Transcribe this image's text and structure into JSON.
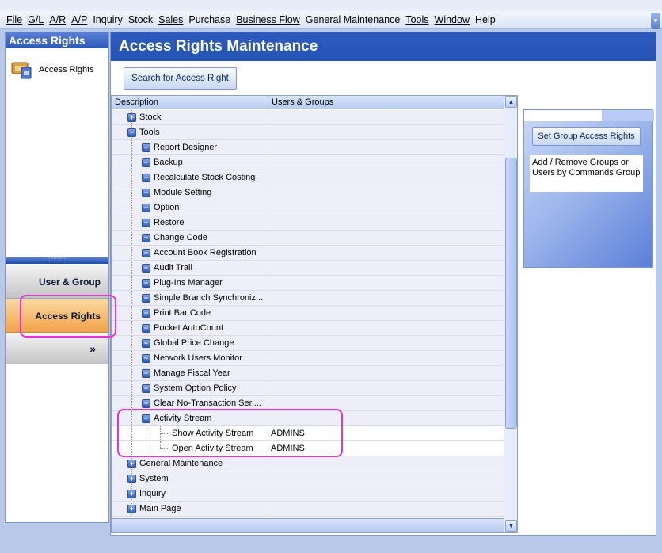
{
  "menu": [
    {
      "label": "File",
      "u": true
    },
    {
      "label": "G/L",
      "u": true
    },
    {
      "label": "A/R",
      "u": true
    },
    {
      "label": "A/P",
      "u": true
    },
    {
      "label": "Inquiry",
      "u": false
    },
    {
      "label": "Stock",
      "u": false
    },
    {
      "label": "Sales",
      "u": true
    },
    {
      "label": "Purchase",
      "u": false
    },
    {
      "label": "Business Flow",
      "u": true
    },
    {
      "label": "General Maintenance",
      "u": false
    },
    {
      "label": "Tools",
      "u": true
    },
    {
      "label": "Window",
      "u": true
    },
    {
      "label": "Help",
      "u": false
    }
  ],
  "nav": {
    "header": "Access Rights",
    "item_label": "Access Rights",
    "grip": "::::::::::",
    "user_group_label": "User & Group",
    "access_rights_label": "Access Rights",
    "more_label": "»"
  },
  "main": {
    "title": "Access Rights Maintenance",
    "search_button": "Search for Access Right",
    "columns": {
      "description": "Description",
      "users_groups": "Users & Groups"
    },
    "rows": [
      {
        "level": 0,
        "label": "Stock",
        "exp": "+",
        "users": ""
      },
      {
        "level": 0,
        "label": "Tools",
        "exp": "-",
        "users": ""
      },
      {
        "level": 1,
        "label": "Report Designer",
        "exp": "+",
        "users": ""
      },
      {
        "level": 1,
        "label": "Backup",
        "exp": "+",
        "users": ""
      },
      {
        "level": 1,
        "label": "Recalculate Stock Costing",
        "exp": "+",
        "users": ""
      },
      {
        "level": 1,
        "label": "Module Setting",
        "exp": "+",
        "users": ""
      },
      {
        "level": 1,
        "label": "Option",
        "exp": "+",
        "users": ""
      },
      {
        "level": 1,
        "label": "Restore",
        "exp": "+",
        "users": ""
      },
      {
        "level": 1,
        "label": "Change Code",
        "exp": "+",
        "users": ""
      },
      {
        "level": 1,
        "label": "Account Book Registration",
        "exp": "+",
        "users": ""
      },
      {
        "level": 1,
        "label": "Audit Trail",
        "exp": "+",
        "users": ""
      },
      {
        "level": 1,
        "label": "Plug-Ins Manager",
        "exp": "+",
        "users": ""
      },
      {
        "level": 1,
        "label": "Simple Branch Synchroniz...",
        "exp": "+",
        "users": ""
      },
      {
        "level": 1,
        "label": "Print Bar Code",
        "exp": "+",
        "users": ""
      },
      {
        "level": 1,
        "label": "Pocket AutoCount",
        "exp": "+",
        "users": ""
      },
      {
        "level": 1,
        "label": "Global Price Change",
        "exp": "+",
        "users": ""
      },
      {
        "level": 1,
        "label": "Network Users Monitor",
        "exp": "+",
        "users": ""
      },
      {
        "level": 1,
        "label": "Manage Fiscal Year",
        "exp": "+",
        "users": ""
      },
      {
        "level": 1,
        "label": "System Option Policy",
        "exp": "+",
        "users": ""
      },
      {
        "level": 1,
        "label": "Clear No-Transaction Seri...",
        "exp": "+",
        "users": ""
      },
      {
        "level": 1,
        "label": "Activity Stream",
        "exp": "-",
        "users": ""
      },
      {
        "level": 2,
        "label": "Show Activity Stream",
        "exp": "",
        "users": "ADMINS"
      },
      {
        "level": 2,
        "label": "Open Activity Stream",
        "exp": "",
        "users": "ADMINS"
      },
      {
        "level": 0,
        "label": "General Maintenance",
        "exp": "+",
        "users": ""
      },
      {
        "level": 0,
        "label": "System",
        "exp": "+",
        "users": ""
      },
      {
        "level": 0,
        "label": "Inquiry",
        "exp": "+",
        "users": ""
      },
      {
        "level": 0,
        "label": "Main Page",
        "exp": "+",
        "users": ""
      }
    ]
  },
  "task_panel": {
    "set_button": "Set Group Access Rights",
    "description": "Add / Remove Groups or Users by Commands Group"
  },
  "colors": {
    "accent": "#2354b4",
    "highlight": "#e633d8",
    "selected_nav": "#f2a24a"
  }
}
